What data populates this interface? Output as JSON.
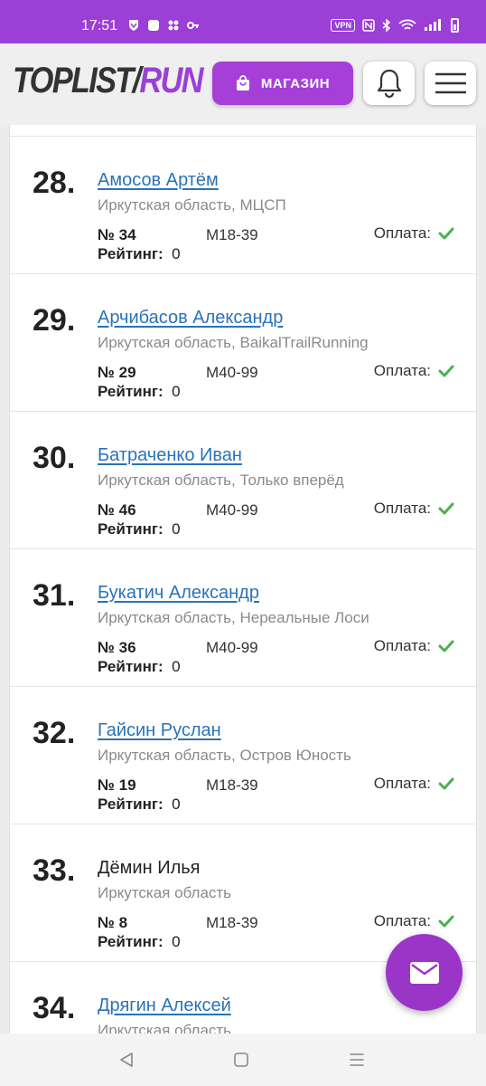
{
  "status_bar": {
    "time": "17:51",
    "vpn": "VPN"
  },
  "header": {
    "logo_part1": "TOPLIST/",
    "logo_part2": "RUN",
    "shop_label": "МАГАЗИН"
  },
  "entries": [
    {
      "rank": "28.",
      "name": "Амосов Артём",
      "link": true,
      "region": "Иркутская область, МЦСП",
      "bib": "№ 34",
      "category": "М18-39",
      "payment_label": "Оплата:",
      "rating_label": "Рейтинг:",
      "rating": "0"
    },
    {
      "rank": "29.",
      "name": "Арчибасов Александр",
      "link": true,
      "region": "Иркутская область, BaikalTrailRunning",
      "bib": "№ 29",
      "category": "М40-99",
      "payment_label": "Оплата:",
      "rating_label": "Рейтинг:",
      "rating": "0"
    },
    {
      "rank": "30.",
      "name": "Батраченко Иван",
      "link": true,
      "region": "Иркутская область, Только вперёд",
      "bib": "№ 46",
      "category": "М40-99",
      "payment_label": "Оплата:",
      "rating_label": "Рейтинг:",
      "rating": "0"
    },
    {
      "rank": "31.",
      "name": "Букатич Александр",
      "link": true,
      "region": "Иркутская область, Нереальные Лоси",
      "bib": "№ 36",
      "category": "М40-99",
      "payment_label": "Оплата:",
      "rating_label": "Рейтинг:",
      "rating": "0"
    },
    {
      "rank": "32.",
      "name": "Гайсин Руслан",
      "link": true,
      "region": "Иркутская область, Остров Юность",
      "bib": "№ 19",
      "category": "М18-39",
      "payment_label": "Оплата:",
      "rating_label": "Рейтинг:",
      "rating": "0"
    },
    {
      "rank": "33.",
      "name": "Дёмин Илья",
      "link": false,
      "region": "Иркутская область",
      "bib": "№ 8",
      "category": "М18-39",
      "payment_label": "Оплата:",
      "rating_label": "Рейтинг:",
      "rating": "0"
    },
    {
      "rank": "34.",
      "name": "Дрягин Алексей",
      "link": true,
      "region": "Иркутская область",
      "bib": "",
      "category": "",
      "payment_label": "",
      "rating_label": "",
      "rating": ""
    }
  ],
  "colors": {
    "brand": "#9b3fd6",
    "link": "#2a73b8",
    "check": "#4caf50"
  },
  "icons": {
    "shop": "shopping-bag-icon",
    "bell": "bell-icon",
    "menu": "hamburger-menu-icon",
    "fab": "mail-icon",
    "check": "check-icon"
  }
}
